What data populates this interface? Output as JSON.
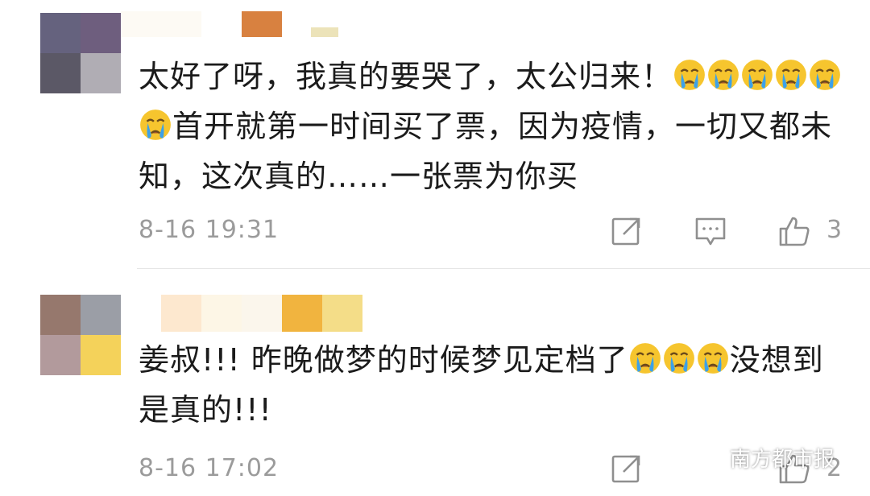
{
  "comments": [
    {
      "text_parts": [
        "太好了呀，我真的要哭了，太公归来！",
        "首开就第一时间买了票，因为疫情，一切又都未知，这次真的……一张票为你买"
      ],
      "emoji_name": "crying-face-icon",
      "time": "8-16 19:31",
      "likes": "3",
      "avatar_colors": [
        "#65627e",
        "#6e5e7e",
        "#5b5866",
        "#b0adb4"
      ],
      "name_blur_colors": [
        "#fdfaf4",
        "#f6f3e6",
        "#d88140",
        "#fbf9f3",
        "#ece3b9"
      ]
    },
    {
      "text_parts": [
        "姜叔!!! 昨晚做梦的时候梦见定档了",
        "没想到是真的!!!"
      ],
      "emoji_name": "crying-face-icon",
      "time": "8-16 17:02",
      "likes": "2",
      "avatar_colors": [
        "#96786d",
        "#9b9ea6",
        "#b29a9c",
        "#f4d25a"
      ],
      "name_blur_colors": [
        "#fde8cf",
        "#fdf6e6",
        "#fbf6ec",
        "#f1b43f",
        "#f4dd88"
      ]
    }
  ],
  "watermark": {
    "text": "南方都市报",
    "icon": "wechat-icon"
  },
  "colors": {
    "meta_gray": "#9b9b9b",
    "text": "#1b1b1b",
    "divider": "#e6e6e6"
  }
}
